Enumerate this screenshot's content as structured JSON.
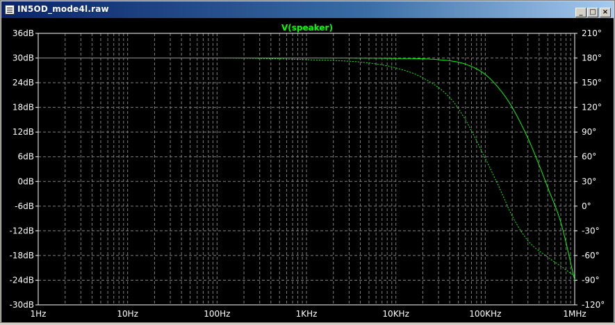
{
  "window": {
    "title": "IN5OD_mode4l.raw",
    "minimize_glyph": "_",
    "maximize_glyph": "□",
    "close_glyph": "×"
  },
  "plot": {
    "trace_label": "V(speaker)",
    "background_color": "#000000",
    "trace_color": "#00ff00",
    "grid_color": "#808080"
  },
  "chart_data": {
    "type": "line",
    "title": "V(speaker)",
    "x_scale": "log",
    "xlim": [
      1,
      1000000
    ],
    "x_ticks": [
      "1Hz",
      "10Hz",
      "100Hz",
      "1KHz",
      "10KHz",
      "100KHz",
      "1MHz"
    ],
    "ylim_left": [
      -30,
      36
    ],
    "y_ticks_left": [
      "36dB",
      "30dB",
      "24dB",
      "18dB",
      "12dB",
      "6dB",
      "0dB",
      "-6dB",
      "-12dB",
      "-18dB",
      "-24dB",
      "-30dB"
    ],
    "ylim_right": [
      -120,
      210
    ],
    "y_ticks_right": [
      "210°",
      "180°",
      "150°",
      "120°",
      "90°",
      "60°",
      "30°",
      "0°",
      "-30°",
      "-60°",
      "-90°",
      "-120°"
    ],
    "grid": true,
    "series": [
      {
        "name": "V(speaker)",
        "axis": "left",
        "style": "solid",
        "x": [
          1,
          100,
          1000,
          10000,
          30000,
          60000,
          100000,
          150000,
          200000,
          300000,
          400000,
          500000,
          700000,
          1000000
        ],
        "y": [
          30,
          30,
          30,
          29.9,
          29.6,
          28.5,
          26,
          22,
          18,
          10.5,
          4,
          -1.5,
          -10,
          -24
        ]
      },
      {
        "name": "V(speaker)",
        "axis": "right",
        "style": "dashed",
        "x": [
          1,
          100,
          1000,
          5000,
          10000,
          20000,
          40000,
          60000,
          100000,
          150000,
          200000,
          300000,
          500000,
          700000,
          1000000
        ],
        "y": [
          180,
          180,
          178,
          174,
          168,
          156,
          132,
          105,
          58,
          18,
          -12,
          -42,
          -62,
          -73,
          -85
        ]
      }
    ]
  }
}
